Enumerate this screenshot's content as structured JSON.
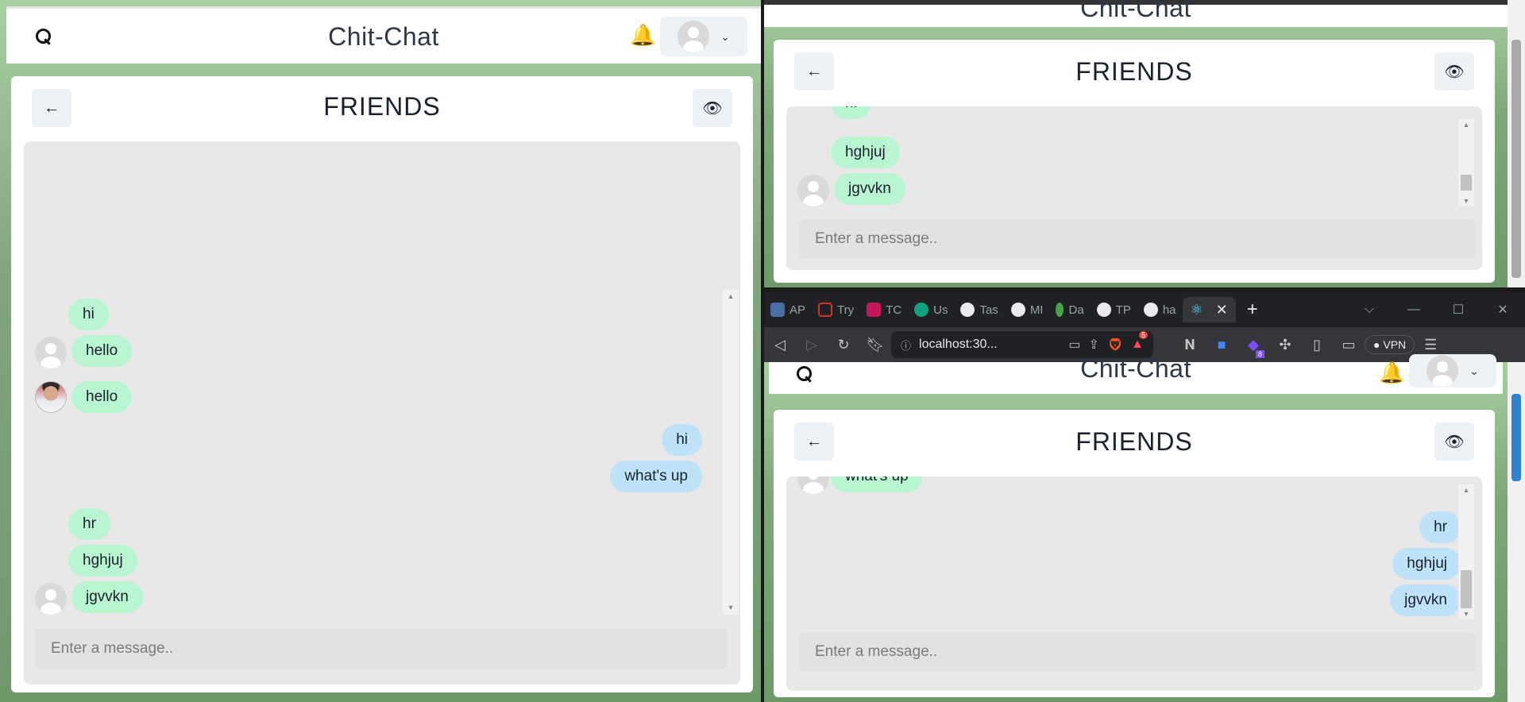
{
  "app": {
    "title": "Chit-Chat"
  },
  "chat": {
    "header_title": "FRIENDS",
    "input_placeholder": "Enter a message..",
    "left_messages": [
      {
        "text": "hi",
        "side": "in"
      },
      {
        "text": "hello",
        "side": "in"
      },
      {
        "text": "hello",
        "side": "in"
      },
      {
        "text": "hi",
        "side": "out"
      },
      {
        "text": "what's up",
        "side": "out"
      },
      {
        "text": "hr",
        "side": "in"
      },
      {
        "text": "hghjuj",
        "side": "in"
      },
      {
        "text": "jgvvkn",
        "side": "in"
      }
    ],
    "right_top_messages": [
      {
        "text": "hi",
        "side": "in"
      },
      {
        "text": "hghjuj",
        "side": "in"
      },
      {
        "text": "jgvvkn",
        "side": "in"
      }
    ],
    "right_bottom_messages": [
      {
        "text": "what's up",
        "side": "in"
      },
      {
        "text": "hr",
        "side": "out"
      },
      {
        "text": "hghjuj",
        "side": "out"
      },
      {
        "text": "jgvvkn",
        "side": "out"
      }
    ]
  },
  "browser": {
    "tabs": [
      {
        "label": "AP",
        "icon": "apinotes-icon",
        "color": "#4a6fa5"
      },
      {
        "label": "Try",
        "icon": "cloud-icon",
        "color": "#d93025"
      },
      {
        "label": "TC",
        "icon": "flag-icon",
        "color": "#c2185b"
      },
      {
        "label": "Us",
        "icon": "chatgpt-icon",
        "color": "#10a37f"
      },
      {
        "label": "Tas",
        "icon": "github-icon",
        "color": "#e8eaed"
      },
      {
        "label": "MI",
        "icon": "github-icon",
        "color": "#e8eaed"
      },
      {
        "label": "Da",
        "icon": "mongodb-icon",
        "color": "#47a248"
      },
      {
        "label": "TP",
        "icon": "github-icon",
        "color": "#e8eaed"
      },
      {
        "label": "ha",
        "icon": "github-icon",
        "color": "#e8eaed"
      }
    ],
    "url": "localhost:30...",
    "vpn_label": "VPN",
    "brave_badge": "5",
    "ext_badge": "8"
  },
  "colors": {
    "incoming_bubble": "#b9f5d0",
    "outgoing_bubble": "#bee3f8",
    "chat_bg": "#e8e8e8",
    "page_bg": "#7ea67a",
    "browser_dark": "#202124"
  }
}
